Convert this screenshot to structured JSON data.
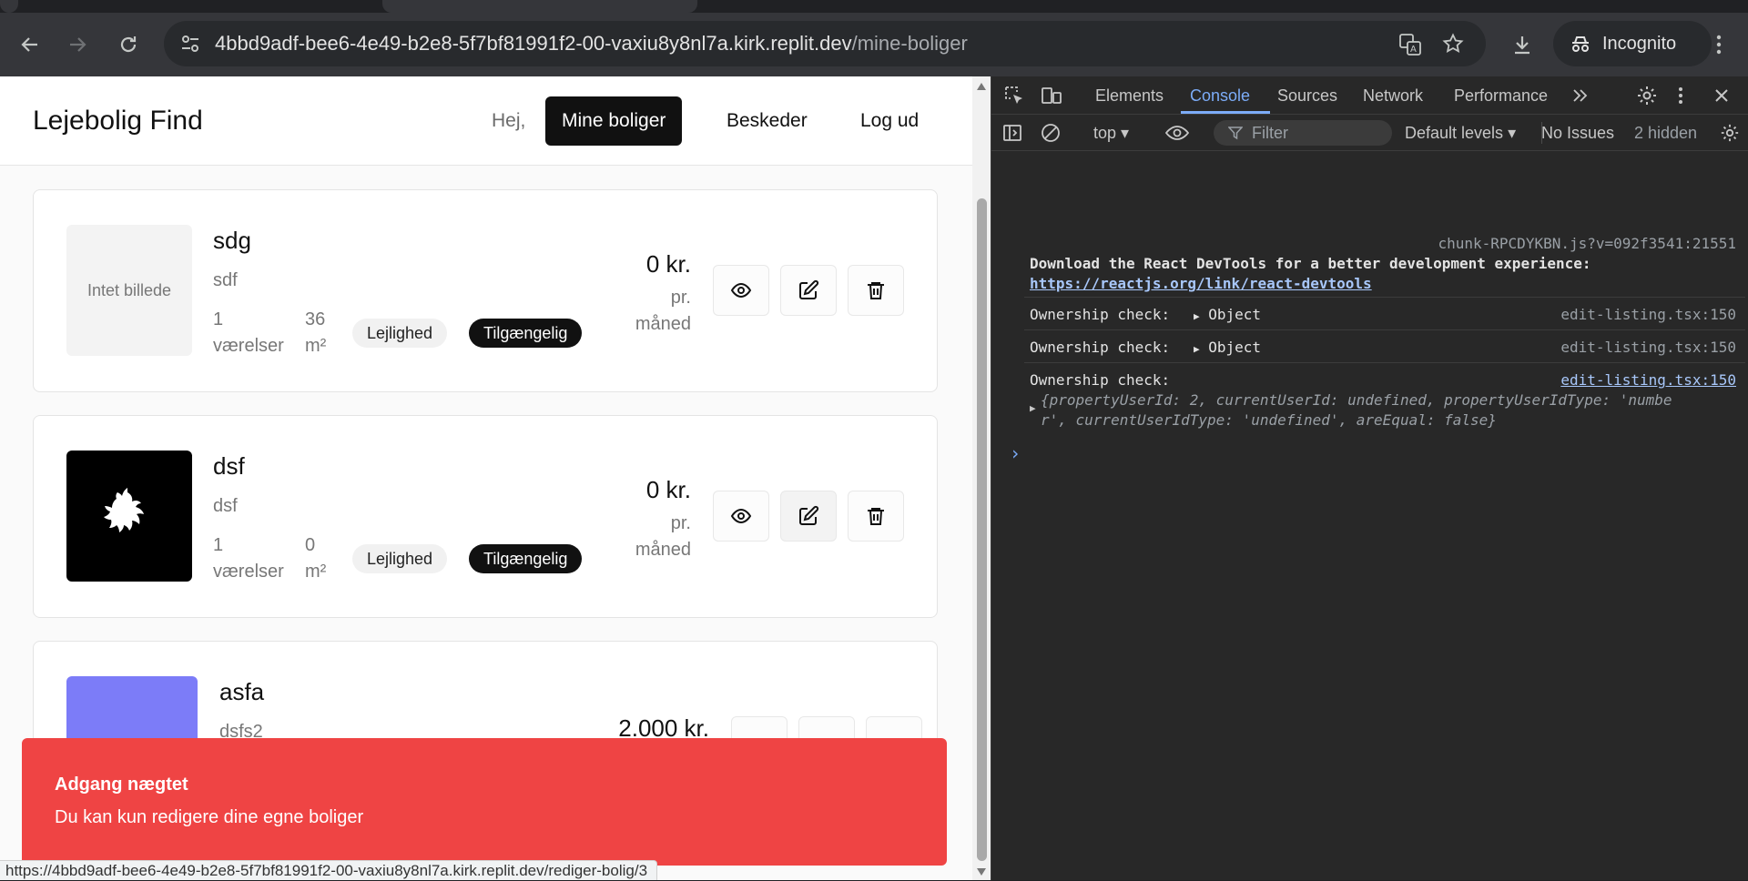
{
  "browser": {
    "url_host": "4bbd9adf-bee6-4e49-b2e8-5f7bf81991f2-00-vaxiu8y8nl7a.kirk.replit.dev",
    "url_path": "/mine-boliger",
    "incognito_label": "Incognito",
    "status_url": "https://4bbd9adf-bee6-4e49-b2e8-5f7bf81991f2-00-vaxiu8y8nl7a.kirk.replit.dev/rediger-bolig/3"
  },
  "header": {
    "brand": "Lejebolig Find",
    "greeting": "Hej,",
    "nav": [
      "Mine boliger",
      "Beskeder",
      "Log ud"
    ]
  },
  "listings": [
    {
      "title": "sdg",
      "description": "sdf",
      "image_placeholder": "Intet billede",
      "rooms_value": "1",
      "rooms_unit": "værelser",
      "area_value": "36",
      "area_unit": "m²",
      "type": "Lejlighed",
      "status": "Tilgængelig",
      "price": "0 kr.",
      "per_1": "pr.",
      "per_2": "måned"
    },
    {
      "title": "dsf",
      "description": "dsf",
      "rooms_value": "1",
      "rooms_unit": "værelser",
      "area_value": "0",
      "area_unit": "m²",
      "type": "Lejlighed",
      "status": "Tilgængelig",
      "price": "0 kr.",
      "per_1": "pr.",
      "per_2": "måned"
    },
    {
      "title": "asfa",
      "description": "dsfs2",
      "price": "2.000 kr.",
      "thumb_color": "#7c7cf8"
    }
  ],
  "toast": {
    "title": "Adgang nægtet",
    "message": "Du kan kun redigere dine egne boliger"
  },
  "devtools": {
    "tabs": [
      "Elements",
      "Console",
      "Sources",
      "Network",
      "Performance"
    ],
    "active_tab": "Console",
    "context": "top",
    "filter_placeholder": "Filter",
    "levels": "Default levels",
    "issues": "No Issues",
    "hidden": "2 hidden",
    "messages": [
      {
        "source": "chunk-RPCDYKBN.js?v=092f3541:21551",
        "line1": "Download the React DevTools for a better development experience:",
        "link": "https://reactjs.org/link/react-devtools"
      },
      {
        "text": "Ownership check:",
        "object": "Object",
        "source": "edit-listing.tsx:150"
      },
      {
        "text": "Ownership check:",
        "object": "Object",
        "source": "edit-listing.tsx:150"
      },
      {
        "text": "Ownership check:",
        "source": "edit-listing.tsx:150",
        "obj_line1": "{propertyUserId: 2, currentUserId: undefined, propertyUserIdType: 'numbe",
        "obj_line2": "r', currentUserIdType: 'undefined', areEqual: false}"
      }
    ],
    "prompt": "›"
  }
}
